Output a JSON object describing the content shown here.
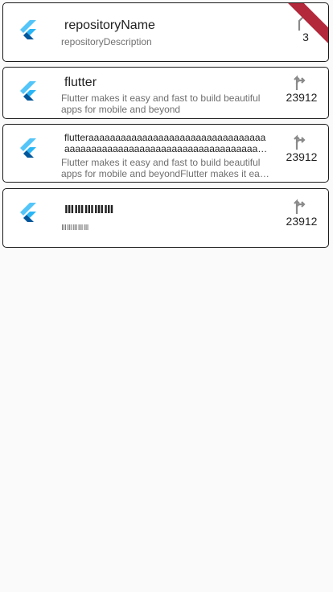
{
  "repositories": [
    {
      "name": "repositoryName",
      "description": "repositoryDescription",
      "forks": "3"
    },
    {
      "name": "flutter",
      "description": "Flutter makes it easy and fast to build beautiful apps for mobile and beyond",
      "forks": "23912"
    },
    {
      "name": "flutteraaaaaaaaaaaaaaaaaaaaaaaaaaaaaaaaaaaaaaaaaaaaaaaaaaaaaaaaaaaaaaaaaaaaaaaaaaaaaaaaaaaaaaa",
      "description": "Flutter makes it easy and fast to build beautiful apps for mobile and beyondFlutter makes it easy and fast to build beautiful apps for mobile and beyond",
      "forks": "23912"
    },
    {
      "name": "ⅢⅢⅢⅢⅢ",
      "description": "ⅢⅢⅢⅢⅢ",
      "forks": "23912"
    }
  ],
  "icons": {
    "logo": "flutter-logo-icon",
    "fork": "fork-icon"
  },
  "colors": {
    "flutter_light": "#54c5f8",
    "flutter_dark": "#01579b",
    "debug_banner": "#b3283b",
    "fork_icon": "#8a8a8a"
  }
}
